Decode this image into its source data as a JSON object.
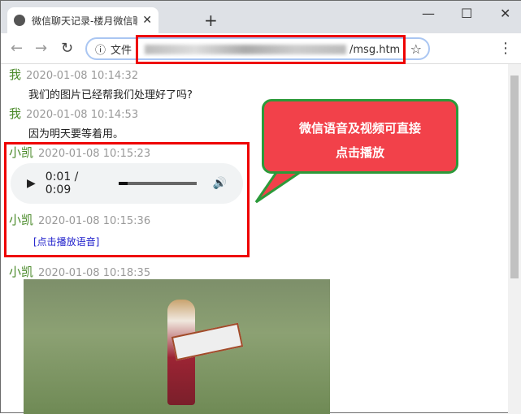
{
  "browser": {
    "tab_title": "微信聊天记录-楼月微信聊天记录",
    "new_tab": "+",
    "url_prefix": "文件",
    "url_suffix": "/msg.htm"
  },
  "messages": [
    {
      "sender": "我",
      "time": "2020-01-08 10:14:32",
      "text": "我们的图片已经帮我们处理好了吗?"
    },
    {
      "sender": "我",
      "time": "2020-01-08 10:14:53",
      "text": "因为明天要等着用。"
    },
    {
      "sender": "小凯",
      "time": "2020-01-08 10:15:23",
      "audio": {
        "time": "0:01 / 0:09",
        "progress": 0.11
      }
    },
    {
      "sender": "小凯",
      "time": "2020-01-08 10:15:36",
      "link": "[点击播放语音]"
    },
    {
      "sender": "小凯",
      "time": "2020-01-08 10:18:35"
    }
  ],
  "callout": {
    "line1": "微信语音及视频可直接",
    "line2": "点击播放"
  },
  "colors": {
    "sender": "#4a8a2a",
    "highlight": "#ee0000",
    "callout": "#f2414a"
  }
}
